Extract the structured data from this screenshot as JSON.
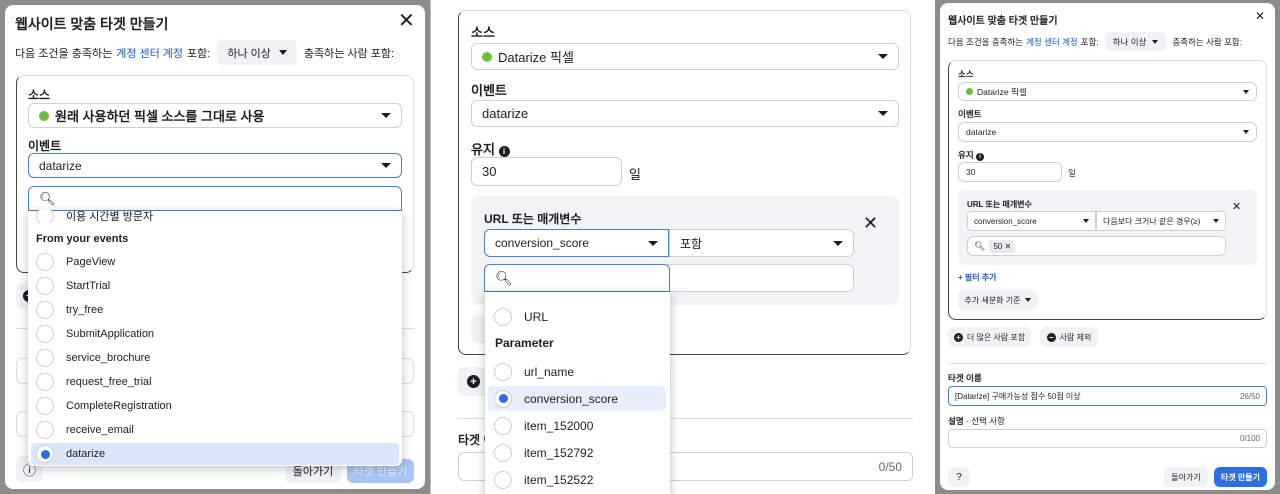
{
  "left": {
    "title": "웹사이트 맞춤 타겟 만들기",
    "condition": {
      "prefix": "다음 조건을 충족하는",
      "link": "계정 센터 계정",
      "include": "포함:",
      "match": "하나 이상",
      "suffix": "충족하는 사람 포함:"
    },
    "source_label": "소스",
    "source_value": "원래 사용하던 픽셀 소스를 그대로 사용",
    "event_label": "이벤트",
    "event_value": "datarize",
    "menu": {
      "partial_item": "이용 시간별 방문자",
      "section": "From your events",
      "items": [
        "PageView",
        "StartTrial",
        "try_free",
        "SubmitApplication",
        "service_brochure",
        "request_free_trial",
        "CompleteRegistration",
        "receive_email",
        "datarize"
      ],
      "selected": "datarize"
    },
    "back": "돌아가기",
    "create": "타겟 만들기"
  },
  "middle": {
    "source_label": "소스",
    "source_value": "Datarize 픽셀",
    "event_label": "이벤트",
    "event_value": "datarize",
    "retention_label": "유지",
    "retention_value": "30",
    "retention_unit": "일",
    "url_label": "URL 또는 매개변수",
    "param_value": "conversion_score",
    "operator_value": "포함",
    "menu": {
      "first": "URL",
      "section": "Parameter",
      "items": [
        "url_name",
        "conversion_score",
        "item_152000",
        "item_152792",
        "item_152522"
      ],
      "selected": "conversion_score"
    },
    "name_label": "타겟 이",
    "name_count": "0/50"
  },
  "right": {
    "title": "웹사이트 맞춤 타겟 만들기",
    "condition": {
      "prefix": "다음 조건을 충족하는",
      "link": "계정 센터 계정",
      "include": "포함:",
      "match": "하나 이상",
      "suffix": "충족하는 사람 포함:"
    },
    "source_label": "소스",
    "source_value": "Datarize 픽셀",
    "event_label": "이벤트",
    "event_value": "datarize",
    "retention_label": "유지",
    "retention_value": "30",
    "retention_unit": "일",
    "url_label": "URL 또는 매개변수",
    "param_value": "conversion_score",
    "operator_value": "다음보다 크거나 같은 경우(≥)",
    "chip": "50",
    "add_filter": "+ 필터 추가",
    "refine": "추가 세분화 기준",
    "include_more": "더 많은 사람 포함",
    "exclude": "사람 제외",
    "name_label": "타겟 이름",
    "name_value": "[Datarize] 구매가능성 점수 50점 이상",
    "name_count": "26/50",
    "desc_label": "설명",
    "desc_optional": "· 선택 사항",
    "desc_count": "0/100",
    "back": "돌아가기",
    "create": "타겟 만들기"
  }
}
